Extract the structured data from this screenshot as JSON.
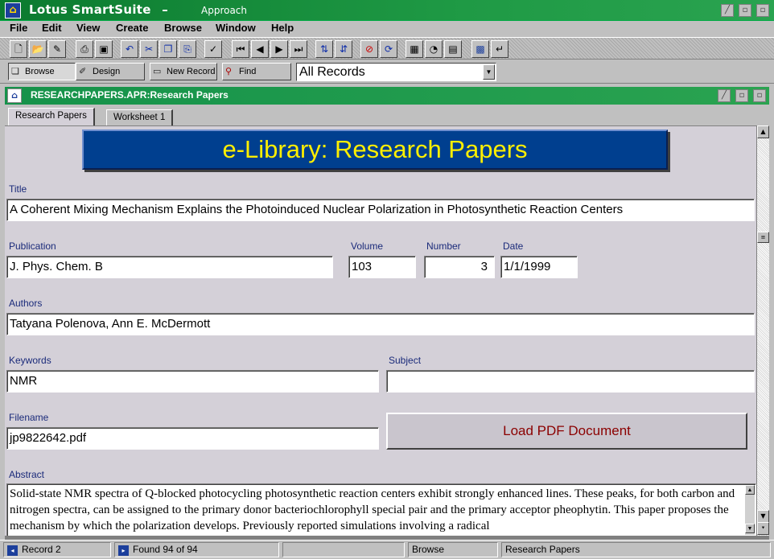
{
  "app": {
    "title": "Lotus SmartSuite",
    "separator": "–",
    "subtitle": "Approach",
    "icon": "lotus-app-icon"
  },
  "window_controls": {
    "minimize": "▫",
    "restore": "▫",
    "close": "▫"
  },
  "menu": {
    "items": [
      {
        "label": "File"
      },
      {
        "label": "Edit"
      },
      {
        "label": "View"
      },
      {
        "label": "Create"
      },
      {
        "label": "Browse"
      },
      {
        "label": "Window"
      },
      {
        "label": "Help"
      }
    ]
  },
  "toolbar": {
    "icons": [
      "new-document-icon",
      "open-folder-icon",
      "attach-icon",
      "print-icon",
      "preview-icon",
      "undo-icon",
      "cut-icon",
      "copy-icon",
      "paste-icon",
      "spell-check-icon",
      "first-record-icon",
      "previous-record-icon",
      "next-record-icon",
      "last-record-icon",
      "sort-ascending-icon",
      "sort-descending-icon",
      "delete-record-icon",
      "refresh-icon",
      "table-icon",
      "chart-icon",
      "report-icon",
      "sql-icon",
      "enter-icon"
    ]
  },
  "modebar": {
    "browse": "Browse",
    "design": "Design",
    "new_record": "New Record",
    "find": "Find",
    "records_select": "All Records"
  },
  "document": {
    "title": "RESEARCHPAPERS.APR:Research Papers",
    "tabs": [
      {
        "label": "Research Papers",
        "active": true
      },
      {
        "label": "Worksheet 1",
        "active": false
      }
    ]
  },
  "form": {
    "banner": "e-Library: Research Papers",
    "title_label": "Title",
    "title_value": "A Coherent Mixing Mechanism Explains the Photoinduced Nuclear Polarization in Photosynthetic Reaction Centers",
    "publication_label": "Publication",
    "publication_value": "J. Phys. Chem. B",
    "volume_label": "Volume",
    "volume_value": "103",
    "number_label": "Number",
    "number_value": "3",
    "date_label": "Date",
    "date_value": "1/1/1999",
    "authors_label": "Authors",
    "authors_value": "Tatyana Polenova, Ann E. McDermott",
    "keywords_label": "Keywords",
    "keywords_value": "NMR",
    "subject_label": "Subject",
    "subject_value": "",
    "filename_label": "Filename",
    "filename_value": "jp9822642.pdf",
    "load_pdf_button": "Load PDF Document",
    "abstract_label": "Abstract",
    "abstract_value": "Solid-state NMR spectra of Q-blocked photocycling photosynthetic reaction centers exhibit strongly enhanced lines. These peaks, for both carbon and nitrogen spectra, can be assigned to the primary donor bacteriochlorophyll special pair and the primary acceptor pheophytin. This paper proposes the mechanism by which the polarization develops. Previously reported simulations involving a radical"
  },
  "statusbar": {
    "record": "Record 2",
    "found": "Found 94 of 94",
    "mode": "Browse",
    "view": "Research Papers"
  }
}
